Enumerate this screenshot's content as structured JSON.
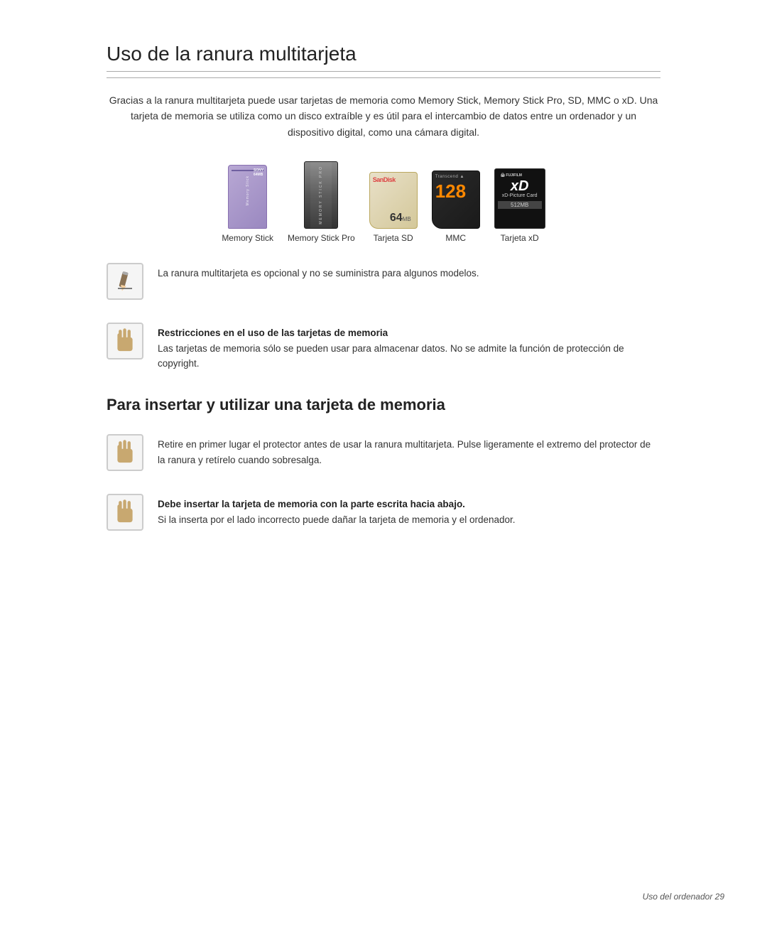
{
  "page": {
    "title": "Uso de la ranura multitarjeta",
    "intro": "Gracias a la ranura multitarjeta puede usar tarjetas de memoria como Memory Stick, Memory Stick Pro, SD, MMC o xD. Una tarjeta de memoria se utiliza como un disco extraíble y es útil para el intercambio de datos entre un ordenador y un dispositivo digital, como una cámara digital.",
    "cards": [
      {
        "label": "Memory Stick"
      },
      {
        "label": "Memory Stick Pro"
      },
      {
        "label": "Tarjeta SD"
      },
      {
        "label": "MMC"
      },
      {
        "label": "Tarjeta xD"
      }
    ],
    "note1": {
      "text": "La ranura multitarjeta es opcional y no se suministra para algunos modelos."
    },
    "note2": {
      "title": "Restricciones en el uso de las tarjetas de memoria",
      "text": "Las tarjetas de memoria sólo se pueden usar para almacenar datos. No se admite la función de protección de copyright."
    },
    "section2": {
      "title": "Para insertar y utilizar una tarjeta de memoria",
      "note1": {
        "text": "Retire en primer lugar el protector antes de usar la ranura multitarjeta. Pulse ligeramente el extremo del protector de la ranura y retírelo cuando sobresalga."
      },
      "note2": {
        "title": "Debe insertar la tarjeta de memoria con la parte escrita hacia abajo.",
        "text": "Si la inserta por el lado incorrecto puede dañar la tarjeta de memoria y el ordenador."
      }
    },
    "footer": {
      "text": "Uso del ordenador  29"
    }
  }
}
